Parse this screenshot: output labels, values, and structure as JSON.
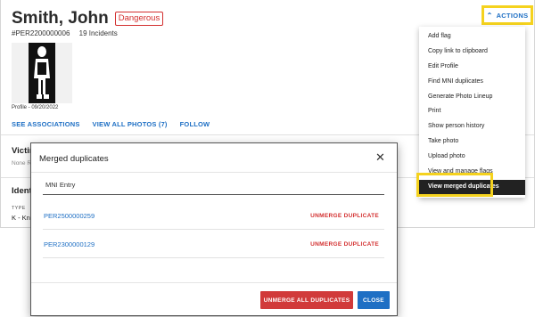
{
  "person": {
    "name": "Smith, John",
    "badge": "Dangerous",
    "record_id": "#PER2200000006",
    "incidents": "19 Incidents",
    "photo_caption": "Profile - 09/20/2022"
  },
  "links": [
    "SEE ASSOCIATIONS",
    "VIEW ALL PHOTOS (7)",
    "FOLLOW"
  ],
  "sections": {
    "victim_title": "Victim",
    "victim_sub": "None Re",
    "ident_title": "Identi",
    "type_label": "TYPE",
    "type_value": "K - Kno"
  },
  "actions": {
    "label": "ACTIONS",
    "menu": [
      "Add flag",
      "Copy link to clipboard",
      "Edit Profile",
      "Find MNI duplicates",
      "Generate Photo Lineup",
      "Print",
      "Show person history",
      "Take photo",
      "Upload photo",
      "View and manage flags",
      "View merged duplicates"
    ],
    "active_item": "View merged duplicates"
  },
  "dialog": {
    "title": "Merged duplicates",
    "column_header": "MNI Entry",
    "rows": [
      {
        "id": "PER2500000259",
        "action": "UNMERGE DUPLICATE"
      },
      {
        "id": "PER2300000129",
        "action": "UNMERGE DUPLICATE"
      }
    ],
    "unmerge_all_label": "UNMERGE ALL DUPLICATES",
    "close_label": "CLOSE"
  },
  "colors": {
    "accent_blue": "#1e6fc4",
    "danger_red": "#d32f2f",
    "highlight_yellow": "#f5d21e"
  }
}
